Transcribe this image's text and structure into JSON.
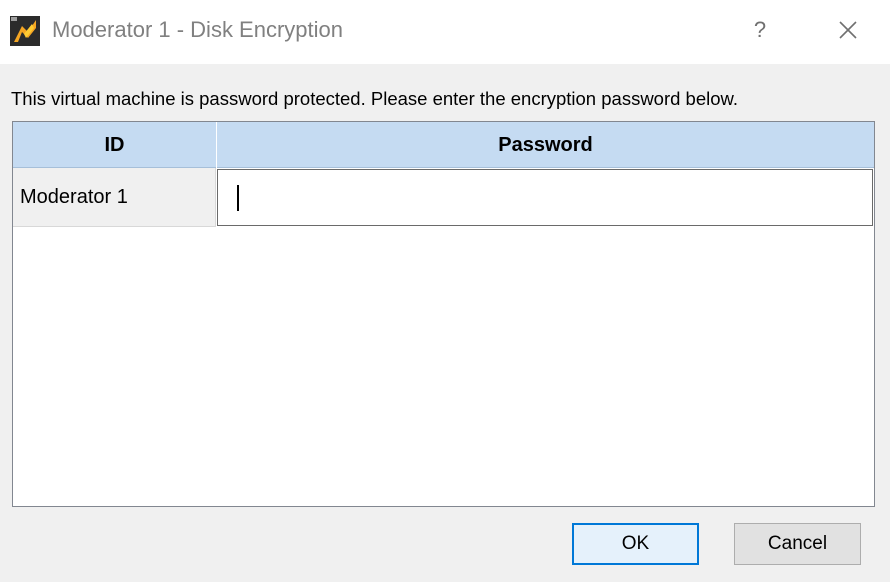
{
  "window": {
    "title": "Moderator 1 - Disk Encryption",
    "help_glyph": "?",
    "icons": {
      "app": "virtualbox-app-icon",
      "close": "close-icon"
    }
  },
  "message": "This virtual machine is password protected. Please enter the encryption password below.",
  "table": {
    "headers": [
      "ID",
      "Password"
    ],
    "header_color": "#c5dbf2",
    "rows": [
      {
        "id": "Moderator 1",
        "password": ""
      }
    ]
  },
  "buttons": {
    "ok_label": "OK",
    "cancel_label": "Cancel",
    "default_accent": "#0078d7"
  }
}
